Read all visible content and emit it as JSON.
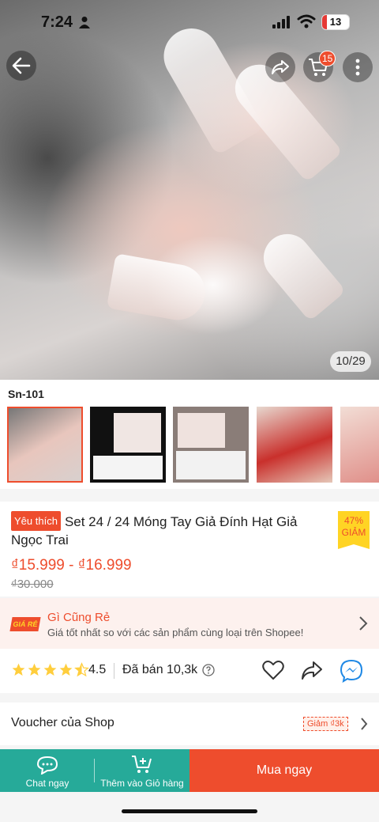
{
  "status_bar": {
    "time": "7:24",
    "battery": "13"
  },
  "top_nav": {
    "cart_count": "15"
  },
  "gallery": {
    "counter": "10/29"
  },
  "variants": {
    "selected_name": "Sn-101",
    "thumbnails": [
      "variant-1",
      "variant-2",
      "variant-3",
      "variant-4",
      "variant-5"
    ]
  },
  "product": {
    "favorite_tag": "Yêu thích",
    "title": "Set 24 / 24 Móng Tay Giả Đính Hạt Giả Ngọc Trai",
    "discount_percent": "47%",
    "discount_label": "GIẢM",
    "price_range": "₫15.999 - ₫16.999",
    "original_price": "₫30.000"
  },
  "cheap_banner": {
    "logo": "GIÁ RẺ",
    "title": "Gì Cũng Rẻ",
    "subtitle": "Giá tốt nhất so với các sản phẩm cùng loại trên Shopee!"
  },
  "rating": {
    "stars": 4.5,
    "value": "4.5",
    "sold": "Đã bán 10,3k"
  },
  "voucher": {
    "label": "Voucher của Shop",
    "tag": "Giảm ₫3k"
  },
  "bottom_bar": {
    "chat_label": "Chat ngay",
    "add_cart_label": "Thêm vào Giỏ hàng",
    "buy_now_label": "Mua ngay"
  },
  "colors": {
    "brand": "#ee4d2d",
    "teal": "#26aa99",
    "star": "#ffce3d"
  }
}
